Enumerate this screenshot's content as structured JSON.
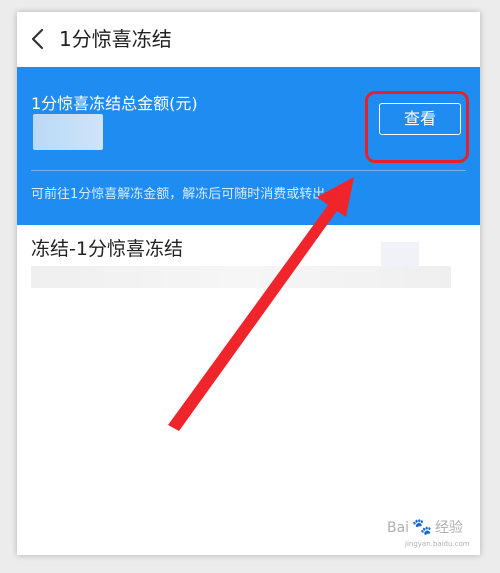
{
  "nav": {
    "title": "1分惊喜冻结",
    "back_icon": "chevron-left-icon"
  },
  "summary": {
    "label": "1分惊喜冻结总金额(元)",
    "view_button": "查看",
    "notice": "可前往1分惊喜解冻金额，解冻后可随时消费或转出",
    "background_color": "#1e8cf0"
  },
  "record": {
    "title": "冻结-1分惊喜冻结"
  },
  "annotation": {
    "highlight_color": "#e8202a",
    "arrow_color": "#f0252c"
  },
  "watermark": {
    "brand_left": "Bai",
    "brand_right": "经验",
    "url": "jingyan.baidu.com"
  }
}
